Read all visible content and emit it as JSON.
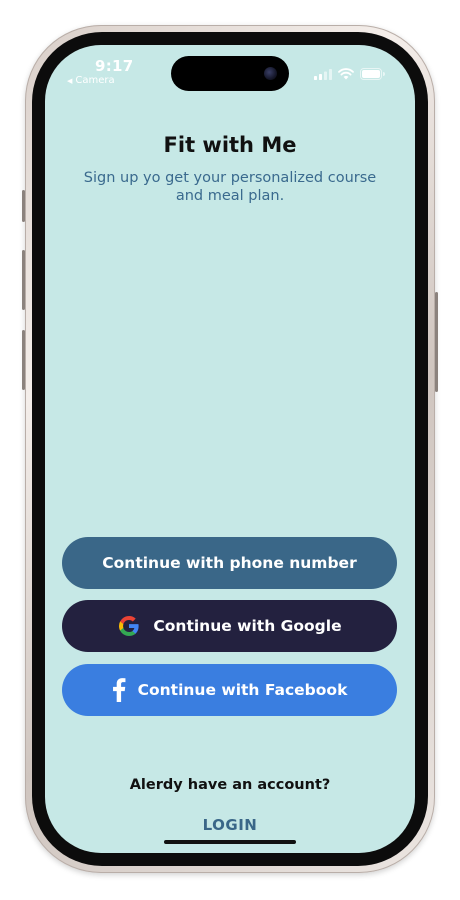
{
  "status_bar": {
    "time": "9:17",
    "back_label": "Camera"
  },
  "app": {
    "title": "Fit with Me",
    "subtitle": "Sign up yo get your personalized course and meal plan."
  },
  "buttons": {
    "phone_label": "Continue with phone number",
    "google_label": "Continue with Google",
    "facebook_label": "Continue with Facebook"
  },
  "footer": {
    "account_prompt": "Alerdy have an account?",
    "login_label": "LOGIN"
  },
  "colors": {
    "screen_background": "#c6e8e6",
    "phone_button": "#3a6788",
    "google_button": "#23213f",
    "facebook_button": "#3a7ee0",
    "subtitle_text": "#3a6a8e",
    "login_link": "#3a6788"
  },
  "icons": {
    "back": "chevron-left-icon",
    "cellular": "cellular-signal-icon",
    "wifi": "wifi-icon",
    "battery": "battery-icon",
    "google": "google-logo-icon",
    "facebook": "facebook-logo-icon"
  }
}
